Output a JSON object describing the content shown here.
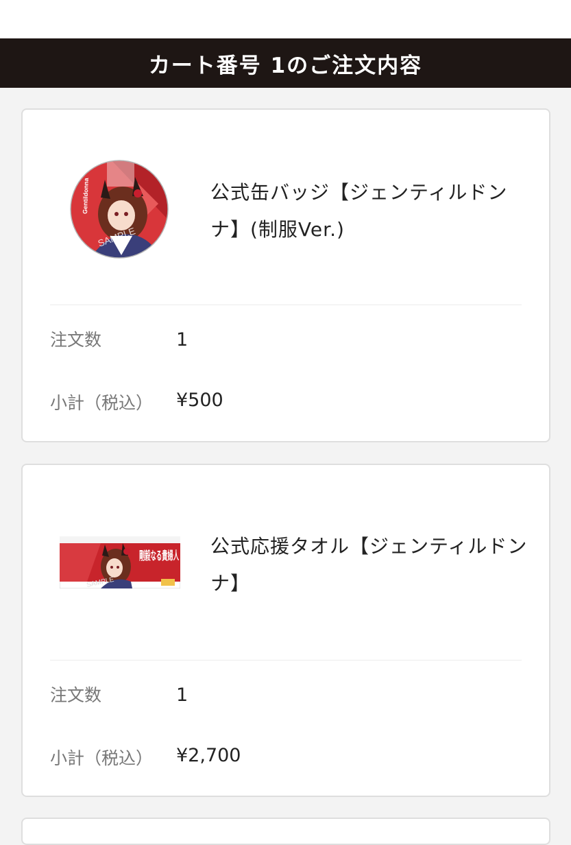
{
  "header": {
    "title": "カート番号 1のご注文内容"
  },
  "items": [
    {
      "name": "公式缶バッジ【ジェンティルドンナ】(制服Ver.)",
      "thumb_icon": "can-badge-image",
      "thumb_text": "Gentildonna",
      "watermark": "SAMPLE",
      "quantity_label": "注文数",
      "quantity": "1",
      "subtotal_label": "小計（税込）",
      "subtotal": "¥500"
    },
    {
      "name": "公式応援タオル【ジェンティルドンナ】",
      "thumb_icon": "cheer-towel-image",
      "thumb_text": "剛毅なる貴婦人",
      "watermark": "SAMPLE",
      "quantity_label": "注文数",
      "quantity": "1",
      "subtotal_label": "小計（税込）",
      "subtotal": "¥2,700"
    }
  ],
  "colors": {
    "header_bg": "#1e1614",
    "page_bg": "#f3f3f3",
    "accent_red": "#c8242b"
  }
}
